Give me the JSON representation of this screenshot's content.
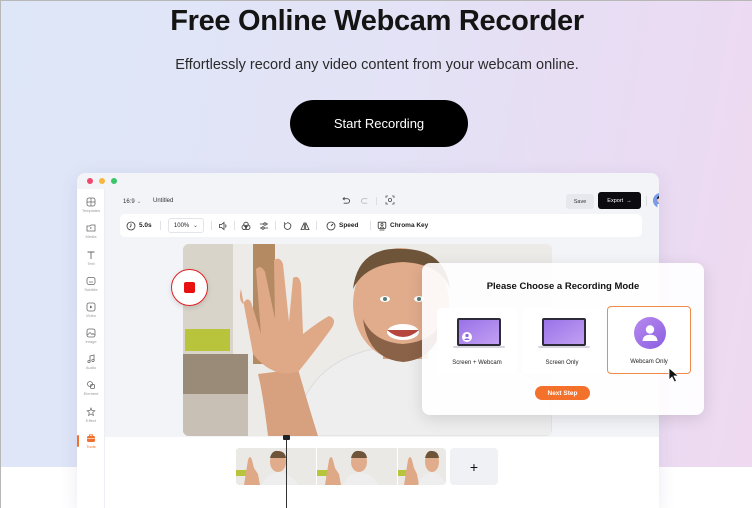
{
  "hero": {
    "title": "Free Online Webcam Recorder",
    "subtitle": "Effortlessly record any video content from your webcam online.",
    "cta_label": "Start Recording"
  },
  "app": {
    "traffic_colors": [
      "#ee4a6e",
      "#f6b73c",
      "#3ac569"
    ],
    "sidebar": {
      "items": [
        {
          "label": "Templates",
          "icon": "templates-icon"
        },
        {
          "label": "Media",
          "icon": "media-icon"
        },
        {
          "label": "Text",
          "icon": "text-icon"
        },
        {
          "label": "Subtitle",
          "icon": "subtitle-icon"
        },
        {
          "label": "Video",
          "icon": "video-icon"
        },
        {
          "label": "Image",
          "icon": "image-icon"
        },
        {
          "label": "Audio",
          "icon": "audio-icon"
        },
        {
          "label": "Element",
          "icon": "element-icon"
        },
        {
          "label": "Effect",
          "icon": "effect-icon"
        },
        {
          "label": "Tools",
          "icon": "tools-icon",
          "active": true
        }
      ]
    },
    "topbar": {
      "aspect_ratio": "16:9",
      "project_name": "Untitled",
      "save_label": "Save",
      "export_label": "Export"
    },
    "toolbar": {
      "duration": "5.0s",
      "zoom": "100%",
      "speed_label": "Speed",
      "chroma_key_label": "Chroma Key"
    },
    "modal": {
      "title": "Please Choose a Recording Mode",
      "modes": [
        {
          "label": "Screen + Webcam",
          "selected": false
        },
        {
          "label": "Screen Only",
          "selected": false
        },
        {
          "label": "Webcam Only",
          "selected": true
        }
      ],
      "next_label": "Next Step"
    },
    "timeline": {
      "add_label": "+"
    },
    "accent": "#f3712a"
  }
}
